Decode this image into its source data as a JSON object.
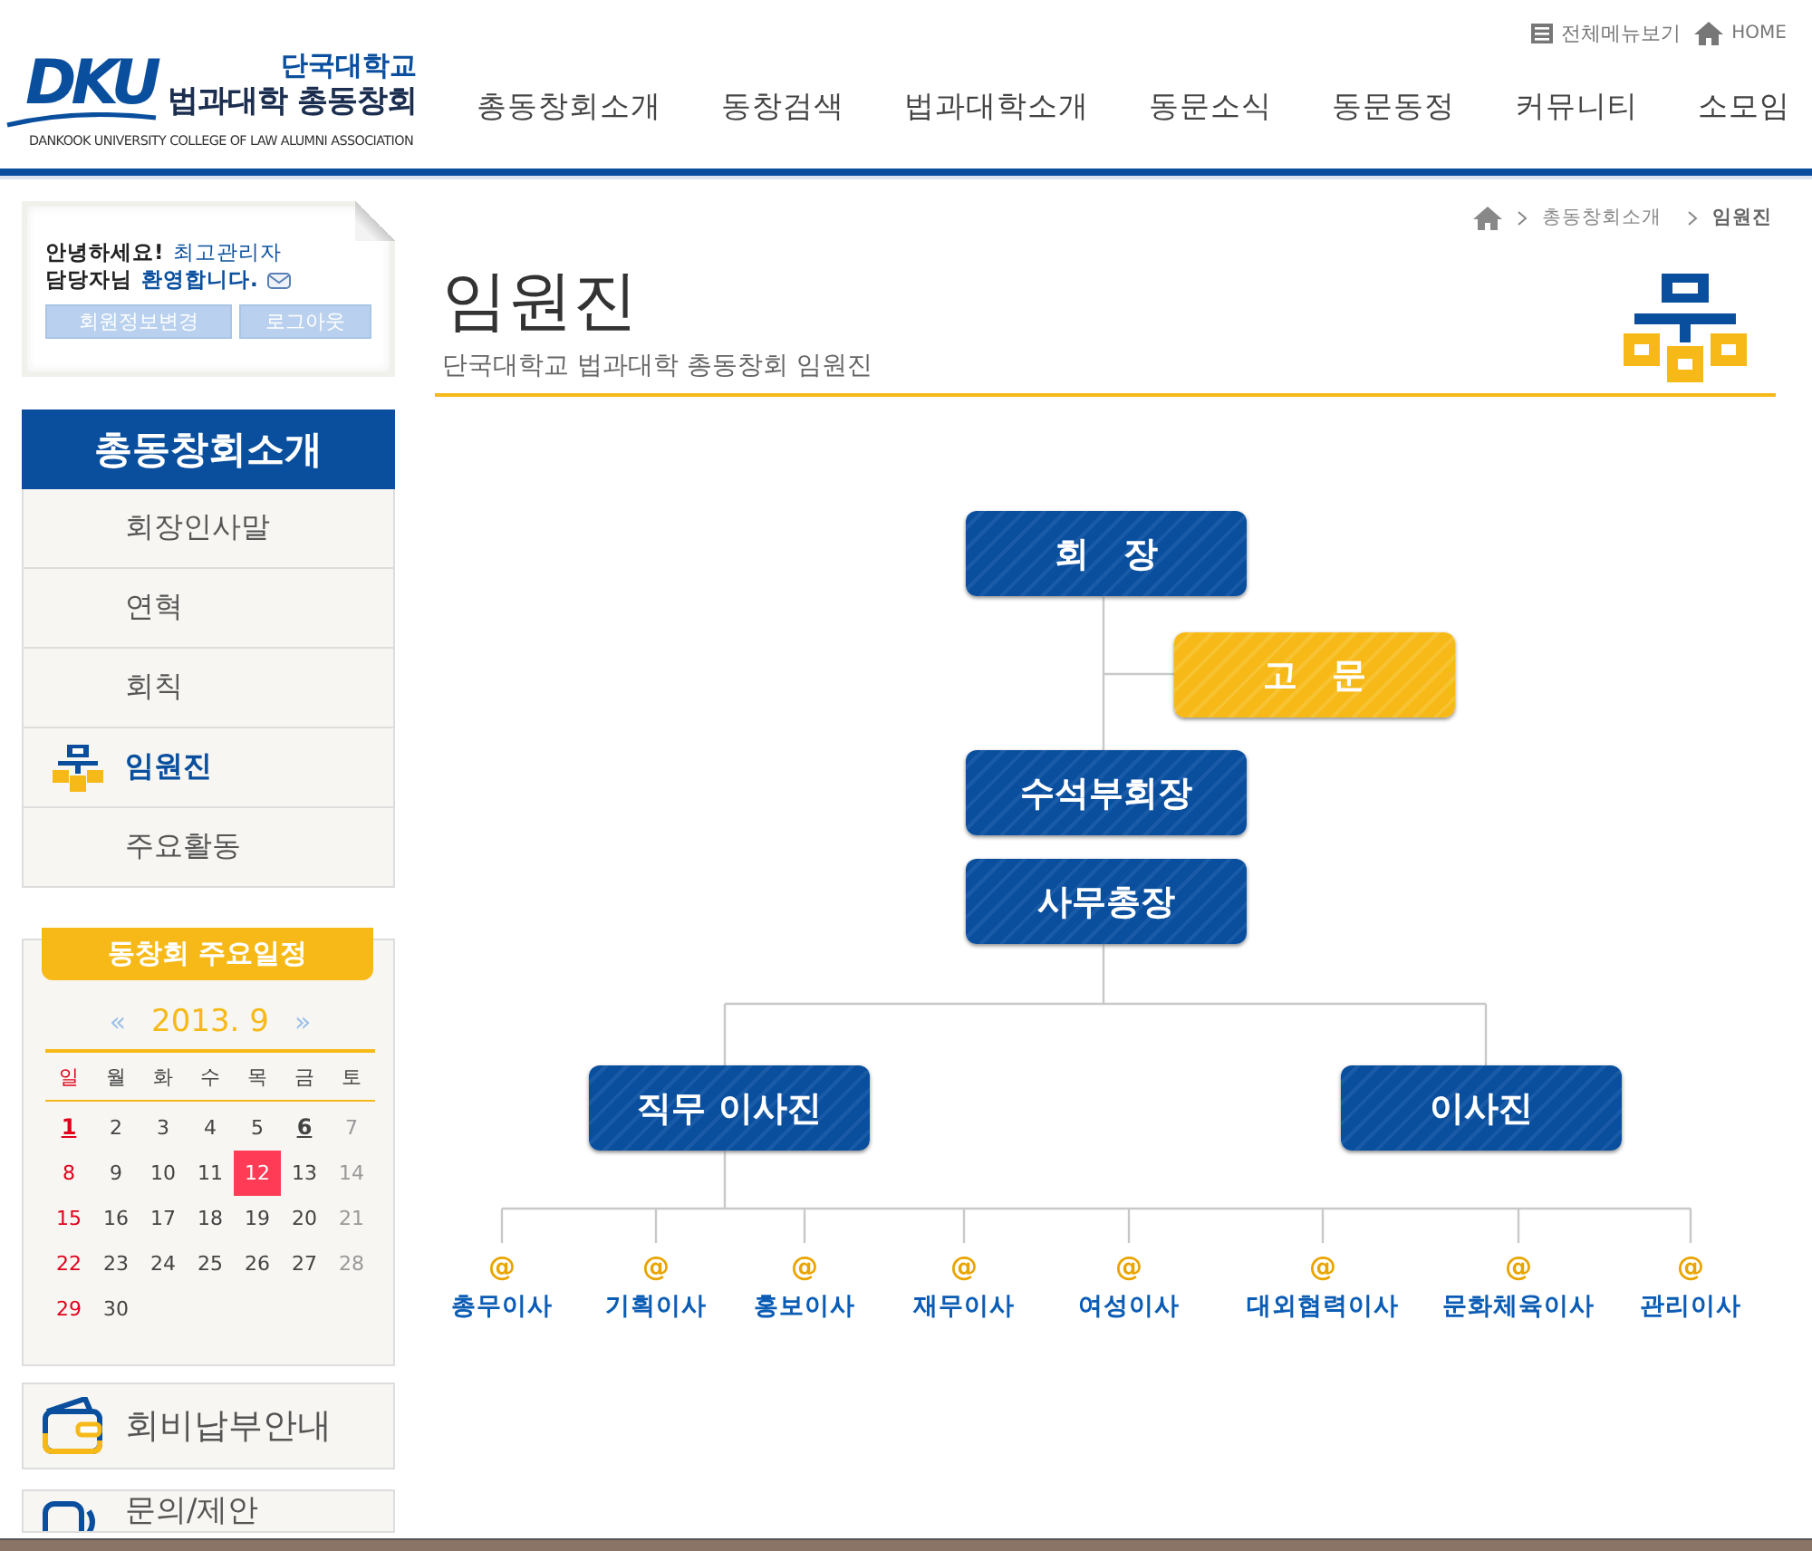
{
  "header": {
    "logo": {
      "mark": "DKU",
      "university": "단국대학교",
      "name": "법과대학 총동창회",
      "english": "DANKOOK UNIVERSITY COLLEGE OF LAW ALUMNI ASSOCIATION"
    },
    "util_links": [
      "전체메뉴보기",
      "HOME"
    ],
    "nav": [
      "총동창회소개",
      "동창검색",
      "법과대학소개",
      "동문소식",
      "동문동정",
      "커뮤니티",
      "소모임"
    ]
  },
  "login_box": {
    "greeting": "안녕하세요!",
    "user": "최고관리자",
    "line2_a": "담당자님",
    "line2_b": "환영합니다.",
    "buttons": [
      "회원정보변경",
      "로그아웃"
    ]
  },
  "sidebar": {
    "title": "총동창회소개",
    "items": [
      {
        "label": "회장인사말",
        "selected": false
      },
      {
        "label": "연혁",
        "selected": false
      },
      {
        "label": "회칙",
        "selected": false
      },
      {
        "label": "임원진",
        "selected": true
      },
      {
        "label": "주요활동",
        "selected": false
      }
    ]
  },
  "calendar": {
    "title": "동창회 주요일정",
    "prev": "«",
    "month": "2013. 9",
    "next": "»",
    "weekdays": [
      {
        "label": "일",
        "kind": "sun"
      },
      {
        "label": "월",
        "kind": "day"
      },
      {
        "label": "화",
        "kind": "day"
      },
      {
        "label": "수",
        "kind": "day"
      },
      {
        "label": "목",
        "kind": "day"
      },
      {
        "label": "금",
        "kind": "day"
      },
      {
        "label": "토",
        "kind": "day"
      }
    ],
    "weeks": [
      [
        {
          "d": "1",
          "kind": "sun",
          "event": true,
          "selected": false
        },
        {
          "d": "2",
          "kind": "day",
          "event": false,
          "selected": false
        },
        {
          "d": "3",
          "kind": "day",
          "event": false,
          "selected": false
        },
        {
          "d": "4",
          "kind": "day",
          "event": false,
          "selected": false
        },
        {
          "d": "5",
          "kind": "day",
          "event": false,
          "selected": false
        },
        {
          "d": "6",
          "kind": "day",
          "event": true,
          "selected": false
        },
        {
          "d": "7",
          "kind": "sat",
          "event": false,
          "selected": false
        }
      ],
      [
        {
          "d": "8",
          "kind": "sun",
          "event": false,
          "selected": false
        },
        {
          "d": "9",
          "kind": "day",
          "event": false,
          "selected": false
        },
        {
          "d": "10",
          "kind": "day",
          "event": false,
          "selected": false
        },
        {
          "d": "11",
          "kind": "day",
          "event": false,
          "selected": false
        },
        {
          "d": "12",
          "kind": "day",
          "event": false,
          "selected": true
        },
        {
          "d": "13",
          "kind": "day",
          "event": false,
          "selected": false
        },
        {
          "d": "14",
          "kind": "sat",
          "event": false,
          "selected": false
        }
      ],
      [
        {
          "d": "15",
          "kind": "sun",
          "event": false,
          "selected": false
        },
        {
          "d": "16",
          "kind": "day",
          "event": false,
          "selected": false
        },
        {
          "d": "17",
          "kind": "day",
          "event": false,
          "selected": false
        },
        {
          "d": "18",
          "kind": "day",
          "event": false,
          "selected": false
        },
        {
          "d": "19",
          "kind": "day",
          "event": false,
          "selected": false
        },
        {
          "d": "20",
          "kind": "day",
          "event": false,
          "selected": false
        },
        {
          "d": "21",
          "kind": "sat",
          "event": false,
          "selected": false
        }
      ],
      [
        {
          "d": "22",
          "kind": "sun",
          "event": false,
          "selected": false
        },
        {
          "d": "23",
          "kind": "day",
          "event": false,
          "selected": false
        },
        {
          "d": "24",
          "kind": "day",
          "event": false,
          "selected": false
        },
        {
          "d": "25",
          "kind": "day",
          "event": false,
          "selected": false
        },
        {
          "d": "26",
          "kind": "day",
          "event": false,
          "selected": false
        },
        {
          "d": "27",
          "kind": "day",
          "event": false,
          "selected": false
        },
        {
          "d": "28",
          "kind": "sat",
          "event": false,
          "selected": false
        }
      ],
      [
        {
          "d": "29",
          "kind": "sun",
          "event": false,
          "selected": false
        },
        {
          "d": "30",
          "kind": "day",
          "event": false,
          "selected": false
        }
      ]
    ]
  },
  "quick_links": [
    "회비납부안내",
    "문의/제안"
  ],
  "breadcrumb": [
    "총동창회소개",
    "임원진"
  ],
  "page": {
    "title": "임원진",
    "subtitle": "단국대학교 법과대학 총동창회 임원진"
  },
  "org_chart": {
    "president": "회　장",
    "advisor": "고　문",
    "vice_president": "수석부회장",
    "secretary_general": "사무총장",
    "executive_board": "직무 이사진",
    "board": "이사진",
    "directors": [
      {
        "mark": "@",
        "label": "총무이사"
      },
      {
        "mark": "@",
        "label": "기획이사"
      },
      {
        "mark": "@",
        "label": "홍보이사"
      },
      {
        "mark": "@",
        "label": "재무이사"
      },
      {
        "mark": "@",
        "label": "여성이사"
      },
      {
        "mark": "@",
        "label": "대외협력이사"
      },
      {
        "mark": "@",
        "label": "문화체육이사"
      },
      {
        "mark": "@",
        "label": "관리이사"
      }
    ]
  }
}
